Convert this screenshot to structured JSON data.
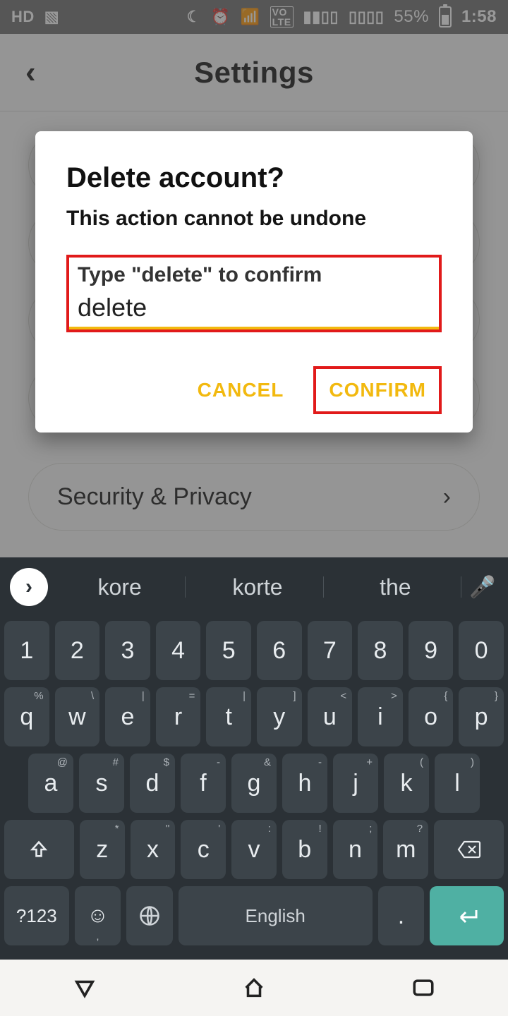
{
  "status": {
    "hd": "HD",
    "battery_pct": "55%",
    "clock": "1:58"
  },
  "app": {
    "title": "Settings",
    "row_visible_label": "Security & Privacy"
  },
  "dialog": {
    "title": "Delete account?",
    "subtitle": "This action cannot be undone",
    "input_label": "Type \"delete\" to confirm",
    "input_value": "delete",
    "cancel_label": "CANCEL",
    "confirm_label": "CONFIRM"
  },
  "keyboard": {
    "suggestions": [
      "kore",
      "korte",
      "the"
    ],
    "row_num": [
      "1",
      "2",
      "3",
      "4",
      "5",
      "6",
      "7",
      "8",
      "9",
      "0"
    ],
    "row_q": [
      [
        "q",
        "%"
      ],
      [
        "w",
        "\\"
      ],
      [
        "e",
        "|"
      ],
      [
        "r",
        "="
      ],
      [
        "t",
        "|"
      ],
      [
        "y",
        "]"
      ],
      [
        "u",
        "<"
      ],
      [
        "i",
        ">"
      ],
      [
        "o",
        "{"
      ],
      [
        "p",
        "}"
      ]
    ],
    "row_a": [
      [
        "a",
        "@"
      ],
      [
        "s",
        "#"
      ],
      [
        "d",
        "$"
      ],
      [
        "f",
        "-"
      ],
      [
        "g",
        "&"
      ],
      [
        "h",
        "-"
      ],
      [
        "j",
        "+"
      ],
      [
        "k",
        "("
      ],
      [
        "l",
        ")"
      ]
    ],
    "row_z": [
      [
        "z",
        "*"
      ],
      [
        "x",
        "\""
      ],
      [
        "c",
        "'"
      ],
      [
        "v",
        ":"
      ],
      [
        "b",
        "!"
      ],
      [
        "n",
        ";"
      ],
      [
        "m",
        "?"
      ]
    ],
    "sym_label": "?123",
    "space_label": "English"
  }
}
